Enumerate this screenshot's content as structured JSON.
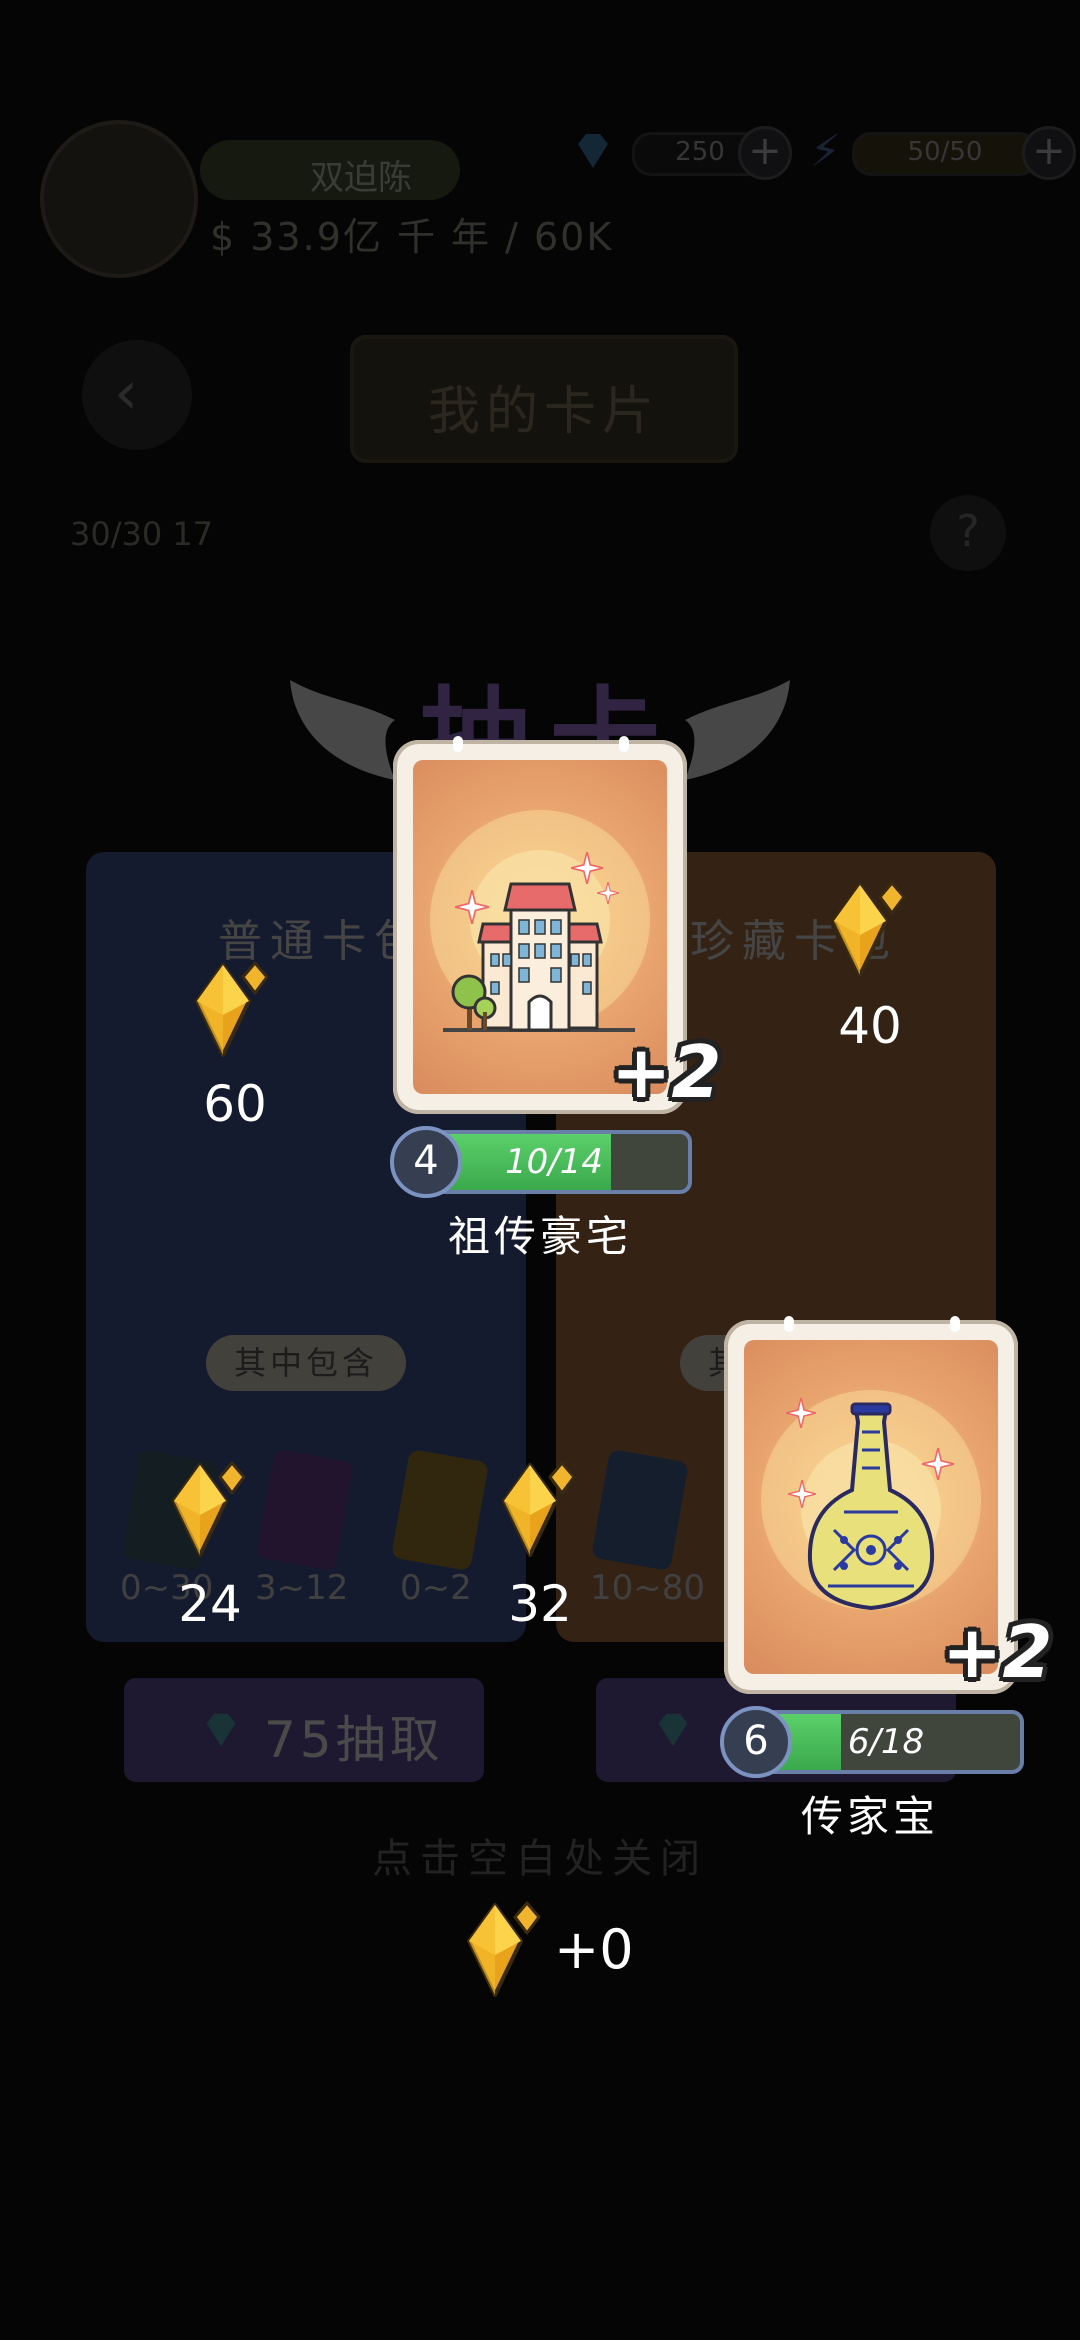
{
  "background": {
    "level_chip": "双迫陈",
    "money_line": "$ 33.9亿 千 年 /  60K",
    "gems_value": "250",
    "energy_value": "50/50",
    "screen_title": "我的卡片",
    "stats_left": "30/30   17",
    "help_label": "?",
    "big_title": "抽卡",
    "pack_normal_title": "普通卡包",
    "pack_rare_title": "珍藏卡包",
    "includes_label": "其中包含",
    "ranges": [
      "0~30",
      "3~12",
      "0~2",
      "10~80"
    ],
    "draw_button_label": "75抽取",
    "close_hint": "点击空白处关闭"
  },
  "gem_counts": {
    "left_pack": "60",
    "right_pack": "40",
    "bottom_left": "24",
    "bottom_mid": "32"
  },
  "cards": [
    {
      "name": "祖传豪宅",
      "bonus": "+2",
      "level": "4",
      "progress_text": "10/14",
      "progress": 0.714,
      "icon": "mansion-icon"
    },
    {
      "name": "传家宝",
      "bonus": "+2",
      "level": "6",
      "progress_text": "6/18",
      "progress": 0.333,
      "icon": "vase-icon"
    }
  ],
  "reward": {
    "count": "+0",
    "icon": "gold-gem-icon"
  },
  "colors": {
    "gold_gem": "#f7c53a",
    "progress_green": "#4cc05c",
    "card_bg": "#e8a36d",
    "level_ring": "#7c93c2"
  }
}
